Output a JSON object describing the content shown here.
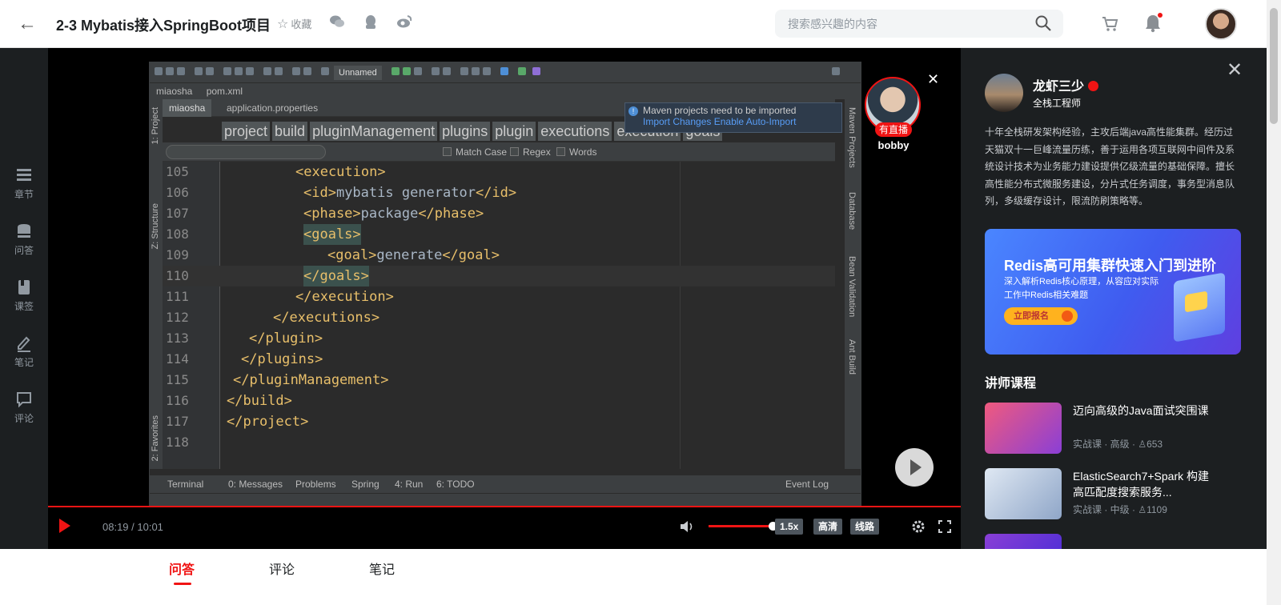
{
  "header": {
    "title": "2-3 Mybatis接入SpringBoot项目",
    "favorite_label": "收藏",
    "search_placeholder": "搜索感兴趣的内容"
  },
  "rail": [
    {
      "label": "章节",
      "icon": "chapter-icon"
    },
    {
      "label": "问答",
      "icon": "qa-icon"
    },
    {
      "label": "课签",
      "icon": "bookmark-icon"
    },
    {
      "label": "笔记",
      "icon": "note-icon"
    },
    {
      "label": "评论",
      "icon": "comment-icon"
    }
  ],
  "ide": {
    "run_config": "Unnamed",
    "breadcrumb": [
      "miaosha",
      "pom.xml"
    ],
    "tabs": [
      "miaosha",
      "application.properties"
    ],
    "tags": [
      "project",
      "build",
      "pluginManagement",
      "plugins",
      "plugin",
      "executions",
      "execution",
      "goals"
    ],
    "maven_popup": {
      "message": "Maven projects need to be imported",
      "import_link": "Import Changes",
      "auto_link": "Enable Auto-Import"
    },
    "find": {
      "match_case": "Match Case",
      "regex": "Regex",
      "words": "Words"
    },
    "lines": [
      {
        "no": "105",
        "text": "<execution>"
      },
      {
        "no": "106",
        "text": "<id>mybatis generator</id>"
      },
      {
        "no": "107",
        "text": "<phase>package</phase>"
      },
      {
        "no": "108",
        "text": "<goals>"
      },
      {
        "no": "109",
        "text": "<goal>generate</goal>"
      },
      {
        "no": "110",
        "text": "</goals>"
      },
      {
        "no": "111",
        "text": "</execution>"
      },
      {
        "no": "112",
        "text": "</executions>"
      },
      {
        "no": "113",
        "text": "</plugin>"
      },
      {
        "no": "114",
        "text": "</plugins>"
      },
      {
        "no": "115",
        "text": "</pluginManagement>"
      },
      {
        "no": "116",
        "text": "</build>"
      },
      {
        "no": "117",
        "text": "</project>"
      },
      {
        "no": "118",
        "text": ""
      }
    ],
    "left_tools": [
      "1: Project",
      "Z: Structure",
      "2: Favorites"
    ],
    "right_tools": [
      "Maven Projects",
      "Database",
      "Bean Validation",
      "Ant Build"
    ],
    "bottom_tools": [
      "Terminal",
      "0: Messages",
      "Problems",
      "Spring",
      "4: Run",
      "6: TODO",
      "Event Log"
    ]
  },
  "live": {
    "badge": "有直播",
    "name": "bobby"
  },
  "controls": {
    "time": "08:19 / 10:01",
    "volume": 0.9,
    "speed": "1.5x",
    "quality": "高清",
    "route": "线路"
  },
  "teacher": {
    "name": "龙虾三少",
    "title": "全栈工程师",
    "desc": "十年全栈研发架构经验，主攻后端java高性能集群。经历过天猫双十一巨峰流量历练，善于运用各项互联网中间件及系统设计技术为业务能力建设提供亿级流量的基础保障。擅长高性能分布式微服务建设，分片式任务调度，事务型消息队列，多级缓存设计，限流防刷策略等。"
  },
  "banner": {
    "title": "Redis高可用集群快速入门到进阶",
    "subtitle": "深入解析Redis核心原理，从容应对实际工作中Redis相关难题",
    "button": "立即报名"
  },
  "courses_heading": "讲师课程",
  "courses": [
    {
      "title": "迈向高级的Java面试突围课",
      "meta": "实战课 · 高级 · ♙653"
    },
    {
      "title": "ElasticSearch7+Spark 构建高匹配度搜索服务...",
      "meta": "实战课 · 中级 · ♙1109"
    }
  ],
  "bottom_tabs": [
    "问答",
    "评论",
    "笔记"
  ],
  "colors": {
    "accent": "#f01414",
    "xml_tag": "#e8bf6a",
    "xml_text": "#a9b7c6"
  }
}
